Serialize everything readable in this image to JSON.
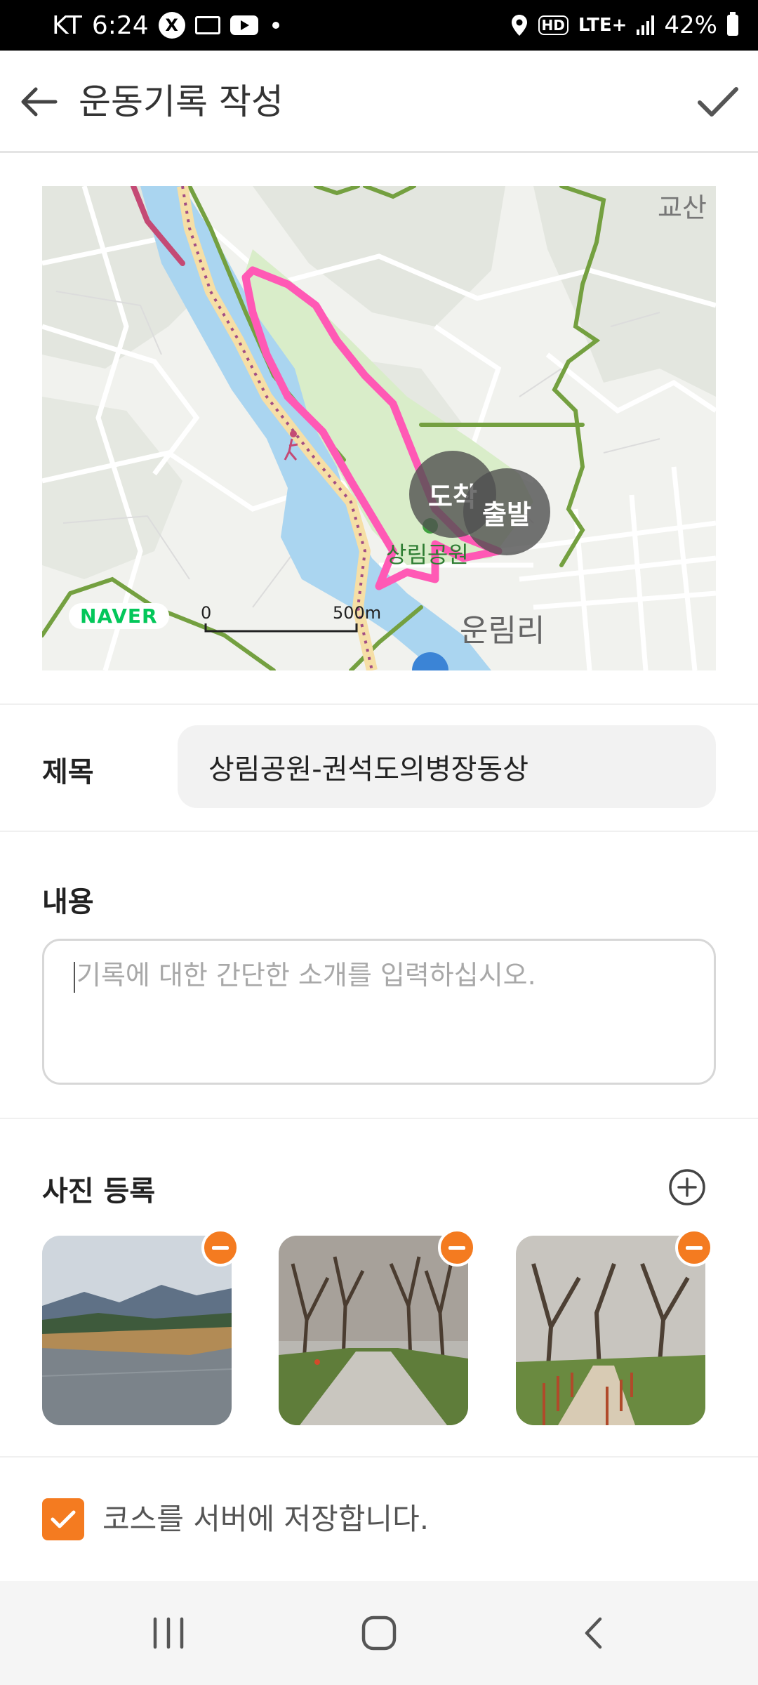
{
  "status_bar": {
    "carrier": "KT",
    "time": "6:24",
    "app_badge": "X",
    "network_small": "HD",
    "network": "LTE+",
    "battery": "42%"
  },
  "header": {
    "title": "운동기록 작성",
    "back_icon": "arrow-left-icon",
    "confirm_icon": "check-icon"
  },
  "map": {
    "logo": "NAVER",
    "scale_start": "0",
    "scale_end": "500m",
    "label_park": "상림공원",
    "label_village": "운림리",
    "label_corner": "교산",
    "marker_end": "도착",
    "marker_start": "출발",
    "route_color": "#ff59b5"
  },
  "form": {
    "title_label": "제목",
    "title_value": "상림공원-권석도의병장동상",
    "content_label": "내용",
    "content_placeholder": "기록에 대한 간단한 소개를 입력하십시오.",
    "photos_label": "사진 등록",
    "save_course_label": "코스를 서버에 저장합니다.",
    "save_course_checked": true
  },
  "photos": [
    {
      "name": "river-photo"
    },
    {
      "name": "forest-path-photo-1"
    },
    {
      "name": "forest-path-photo-2"
    }
  ],
  "colors": {
    "accent": "#f47b20"
  },
  "nav_bar": [
    "recent-apps-icon",
    "home-icon",
    "back-icon"
  ]
}
